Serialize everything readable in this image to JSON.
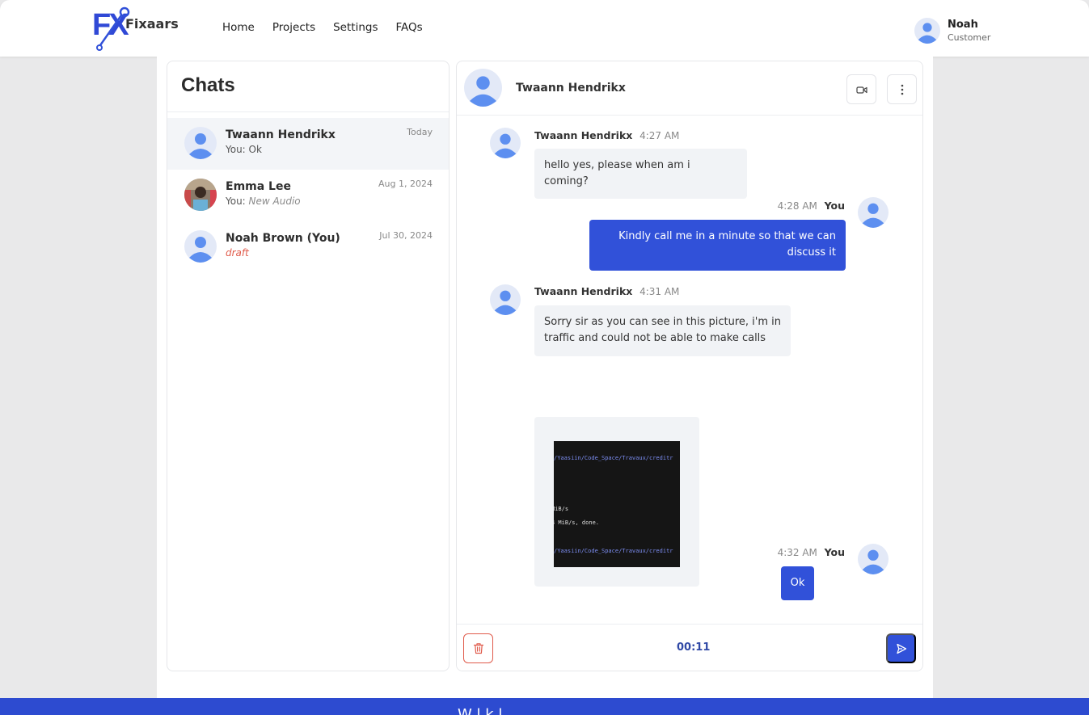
{
  "brand": {
    "logo_letters": "FX",
    "name": "Fixaars",
    "color": "#3151d9"
  },
  "nav": {
    "home": "Home",
    "projects": "Projects",
    "settings": "Settings",
    "faqs": "FAQs"
  },
  "user": {
    "name": "Noah",
    "role": "Customer",
    "icon": "user-avatar-icon"
  },
  "chats": {
    "title": "Chats",
    "items": [
      {
        "name": "Twaann Hendrikx",
        "prefix": "You: ",
        "preview": "Ok",
        "date": "Today",
        "active": true
      },
      {
        "name": "Emma Lee",
        "prefix": "You: ",
        "preview": "New Audio",
        "date": "Aug 1, 2024",
        "active": false
      },
      {
        "name": "Noah Brown (You)",
        "prefix": "",
        "preview": "draft",
        "date": "Jul 30, 2024",
        "active": false
      }
    ]
  },
  "conversation": {
    "title": "Twaann Hendrikx",
    "header_icons": [
      "video-call-icon",
      "more-vertical-icon"
    ],
    "messages": [
      {
        "from": "Twaann Hendrikx",
        "time": "4:27 AM",
        "text": "hello yes, please when am i coming?",
        "outgoing": false
      },
      {
        "from": "You",
        "time": "4:28 AM",
        "line1": "Kindly call me in a minute so that we can",
        "line2": "discuss it",
        "outgoing": true
      },
      {
        "from": "Twaann Hendrikx",
        "time": "4:31 AM",
        "line1": "Sorry sir as you can see in this picture, i'm in",
        "line2": "traffic and could not be able to make calls",
        "outgoing": false
      },
      {
        "from": "You",
        "time": "4:32 AM",
        "text": "Ok",
        "outgoing": true
      }
    ],
    "image_lines": [
      "/Yaasiin/Code_Space/Travaux/creditr",
      "MiB/s",
      "4 MiB/s, done.",
      "/Yaasiin/Code_Space/Travaux/creditr"
    ],
    "recording_timer": "00:11",
    "footer_icons": [
      "trash-icon",
      "send-icon"
    ]
  },
  "footer_band_text": "W     l   k   l"
}
